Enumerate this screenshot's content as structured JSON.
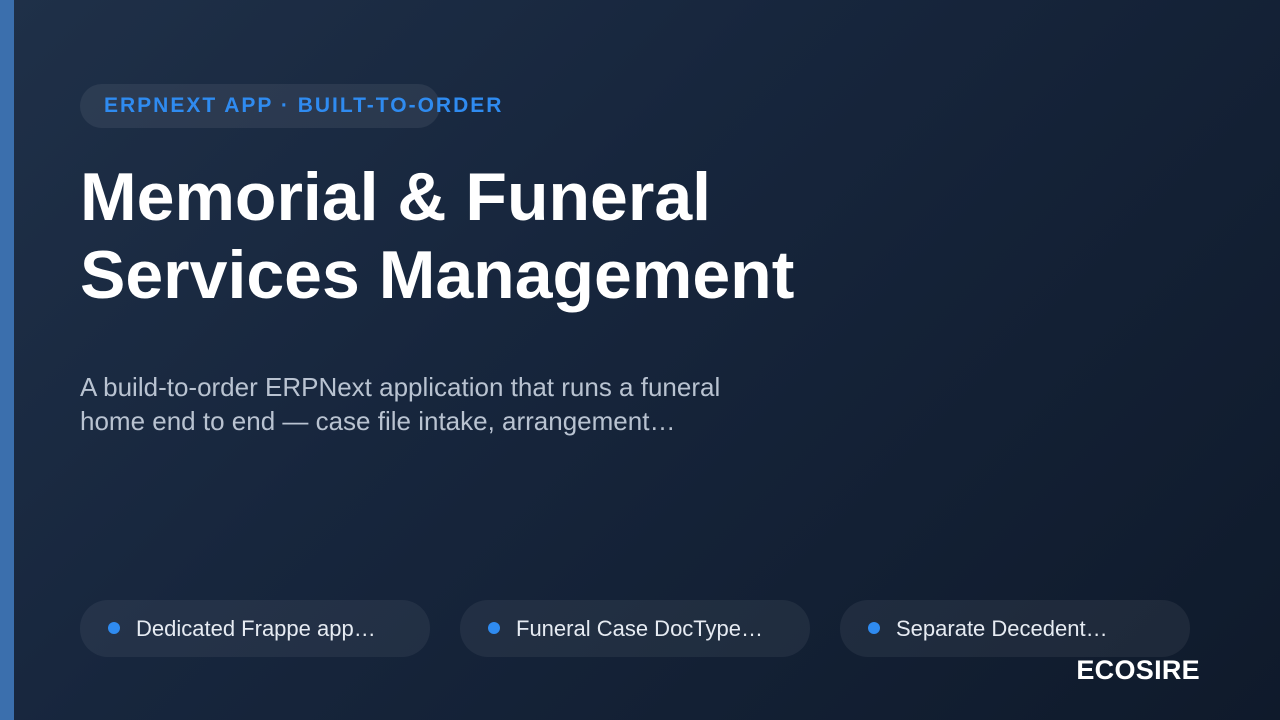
{
  "eyebrow": "ERPNEXT APP · BUILT-TO-ORDER",
  "title": {
    "line1": "Memorial & Funeral",
    "line2": "Services Management"
  },
  "description": {
    "line1": "A build-to-order ERPNext application that runs a funeral",
    "line2": "home end to end — case file intake, arrangement…"
  },
  "features": [
    {
      "label": "Dedicated Frappe app…"
    },
    {
      "label": "Funeral Case DocType…"
    },
    {
      "label": "Separate Decedent…"
    }
  ],
  "brand": "ECOSIRE",
  "colors": {
    "accent": "#2f8bf0",
    "sidebar_bar": "#3b6fad",
    "background_start": "#1f3048",
    "background_end": "#0f1a2b"
  }
}
